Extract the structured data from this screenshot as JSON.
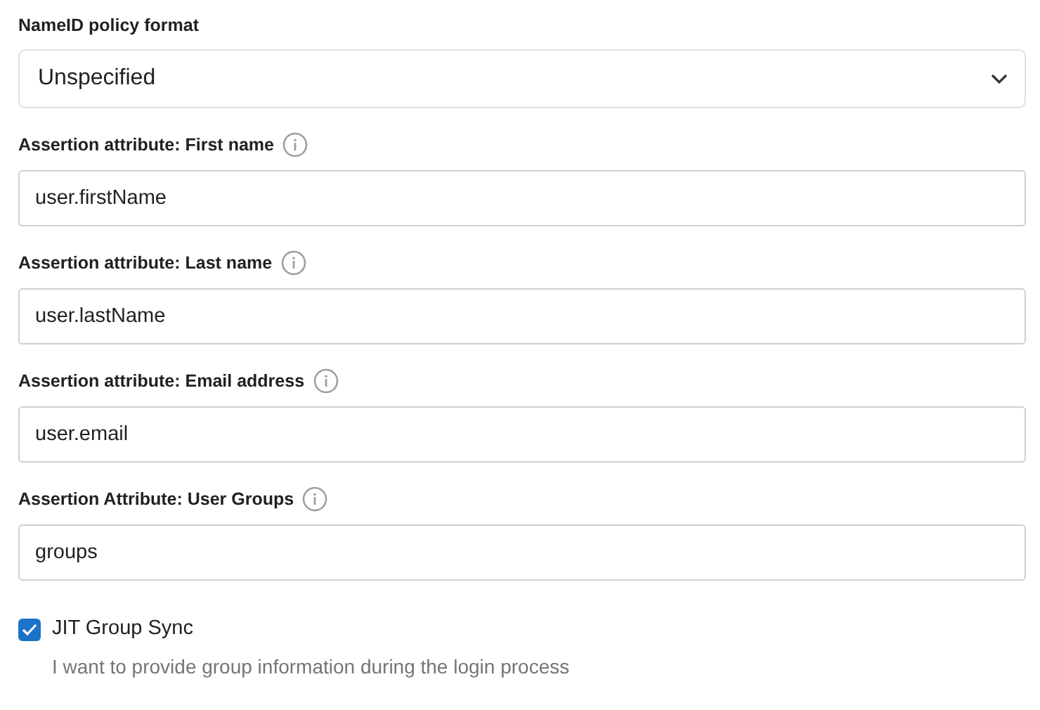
{
  "nameid_policy": {
    "label": "NameID policy format",
    "value": "Unspecified"
  },
  "fields": [
    {
      "label": "Assertion attribute: First name",
      "value": "user.firstName"
    },
    {
      "label": "Assertion attribute: Last name",
      "value": "user.lastName"
    },
    {
      "label": "Assertion attribute: Email address",
      "value": "user.email"
    },
    {
      "label": "Assertion Attribute: User Groups",
      "value": "groups"
    }
  ],
  "jit_group_sync": {
    "label": "JIT Group Sync",
    "checked": true,
    "description": "I want to provide group information during the login process"
  }
}
